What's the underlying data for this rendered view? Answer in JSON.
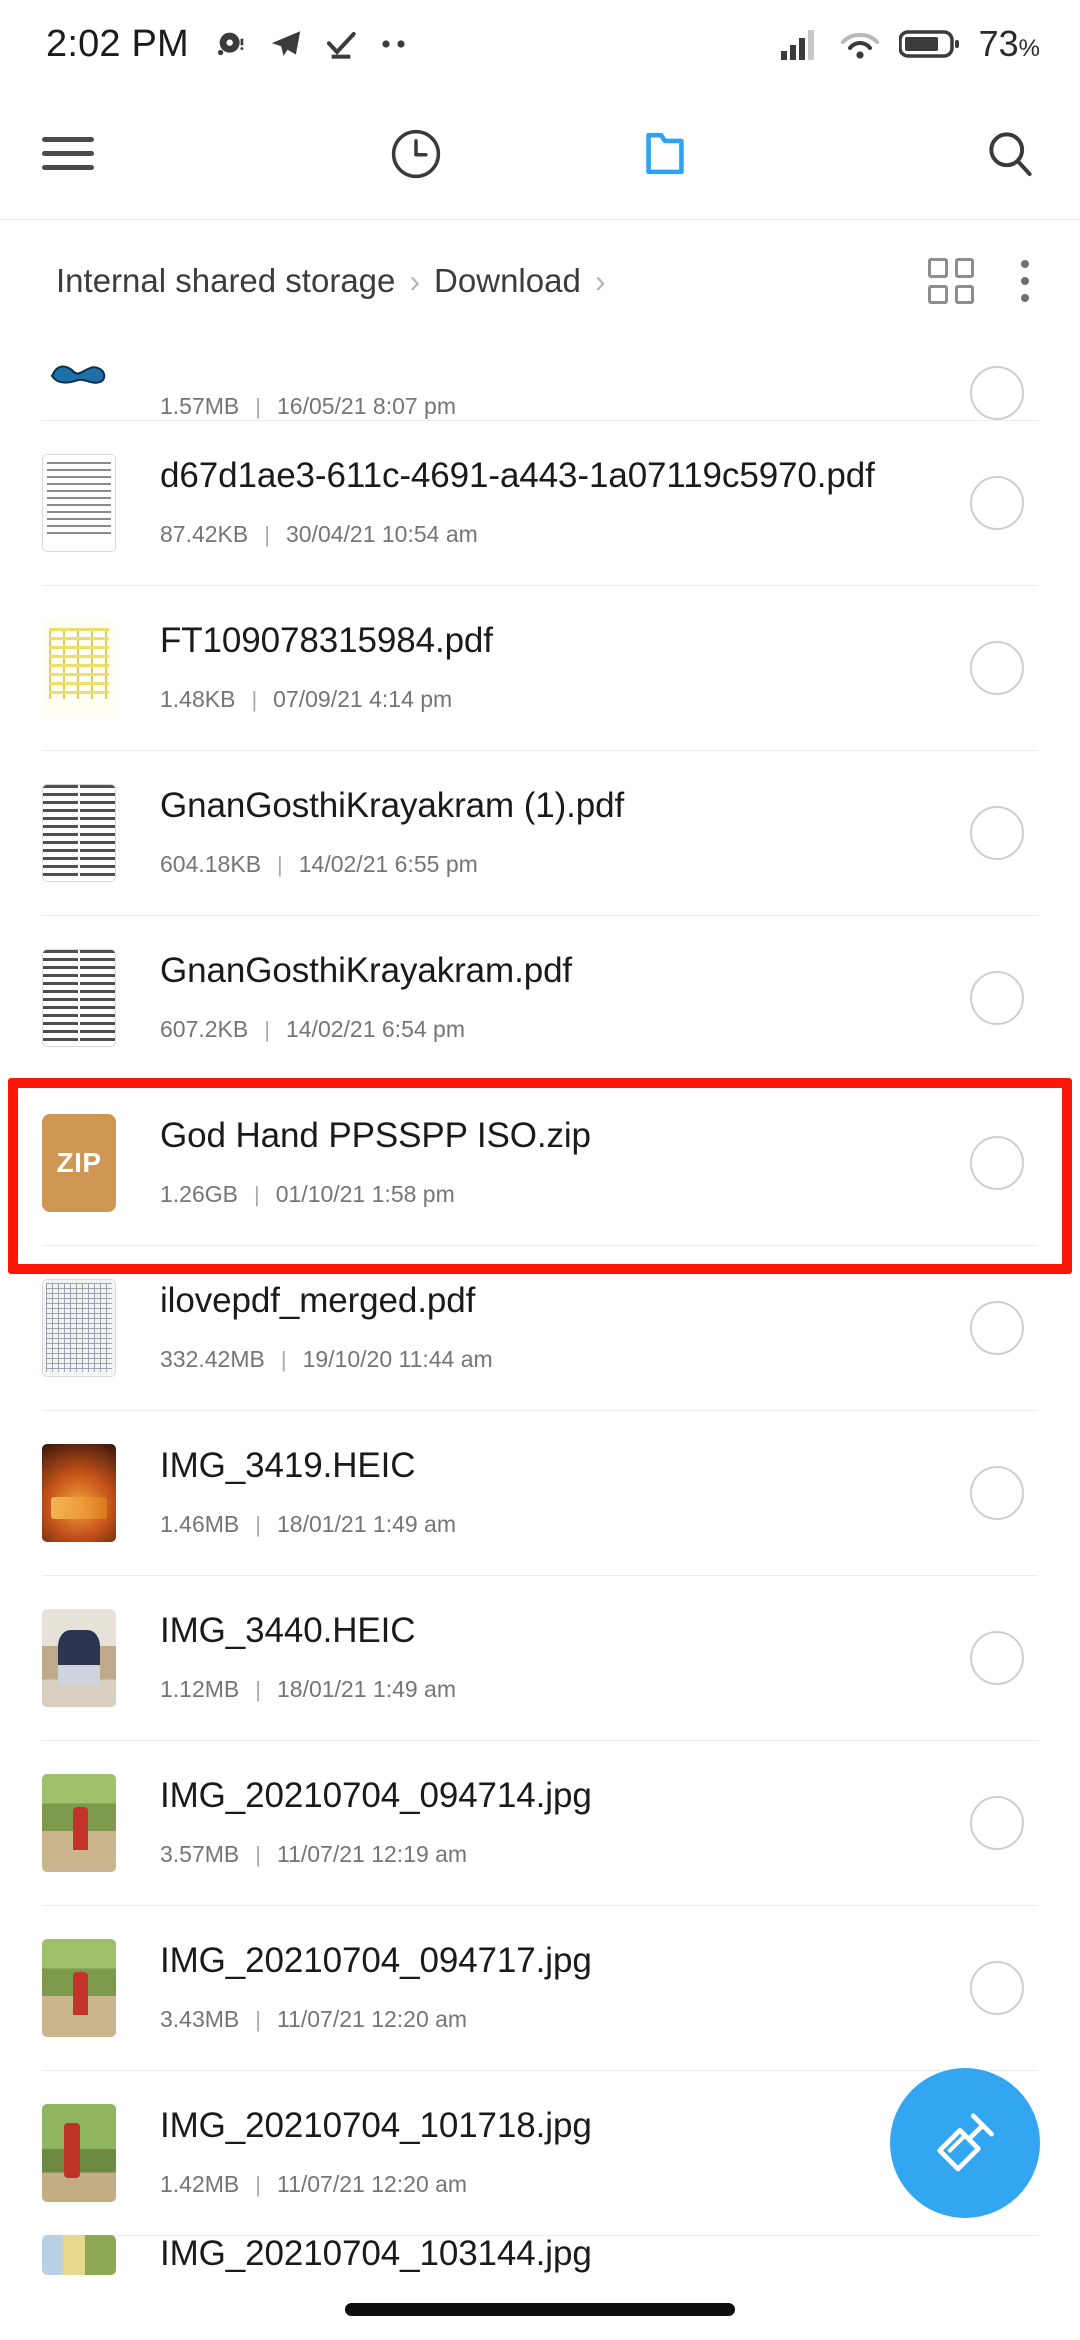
{
  "status_bar": {
    "time": "2:02 PM",
    "battery_percent": "73",
    "battery_unit": "%",
    "left_icons": [
      "notification-dot-icon",
      "telegram-icon",
      "check-icon",
      "more-dots-icon"
    ],
    "right_icons": [
      "cellular-signal-icon",
      "wifi-icon",
      "battery-icon"
    ]
  },
  "toolbar": {
    "menu_icon": "hamburger-menu-icon",
    "recent_icon": "clock-icon",
    "files_icon": "folder-icon",
    "search_icon": "search-icon",
    "active_tab": "files",
    "accent_color": "#2EA3F2"
  },
  "breadcrumb": {
    "items": [
      "Internal shared storage",
      "Download"
    ],
    "separator": "›",
    "trailing_separator": "›",
    "grid_view_icon": "grid-view-icon",
    "overflow_icon": "kebab-menu-icon"
  },
  "files": [
    {
      "name": "",
      "size": "1.57MB",
      "date": "16/05/21 8:07 pm",
      "thumb": "blue-icon",
      "partial": "top"
    },
    {
      "name": "d67d1ae3-611c-4691-a443-1a07119c5970.pdf",
      "size": "87.42KB",
      "date": "30/04/21 10:54 am",
      "thumb": "doc-lines"
    },
    {
      "name": "FT109078315984.pdf",
      "size": "1.48KB",
      "date": "07/09/21 4:14 pm",
      "thumb": "doc-yellow"
    },
    {
      "name": "GnanGosthiKrayakram (1).pdf",
      "size": "604.18KB",
      "date": "14/02/21 6:55 pm",
      "thumb": "doc-two-col"
    },
    {
      "name": "GnanGosthiKrayakram.pdf",
      "size": "607.2KB",
      "date": "14/02/21 6:54 pm",
      "thumb": "doc-two-col"
    },
    {
      "name": "God Hand PPSSPP ISO.zip",
      "size": "1.26GB",
      "date": "01/10/21 1:58 pm",
      "thumb": "zip",
      "thumb_label": "ZIP",
      "highlighted": true
    },
    {
      "name": "ilovepdf_merged.pdf",
      "size": "332.42MB",
      "date": "19/10/20 11:44 am",
      "thumb": "doc-grid"
    },
    {
      "name": "IMG_3419.HEIC",
      "size": "1.46MB",
      "date": "18/01/21 1:49 am",
      "thumb": "photo-boss"
    },
    {
      "name": "IMG_3440.HEIC",
      "size": "1.12MB",
      "date": "18/01/21 1:49 am",
      "thumb": "photo-people"
    },
    {
      "name": "IMG_20210704_094714.jpg",
      "size": "3.57MB",
      "date": "11/07/21 12:19 am",
      "thumb": "photo-outdoor"
    },
    {
      "name": "IMG_20210704_094717.jpg",
      "size": "3.43MB",
      "date": "11/07/21 12:20 am",
      "thumb": "photo-outdoor"
    },
    {
      "name": "IMG_20210704_101718.jpg",
      "size": "1.42MB",
      "date": "11/07/21 12:20 am",
      "thumb": "photo-outdoor2"
    },
    {
      "name": "IMG_20210704_103144.jpg",
      "size": "",
      "date": "",
      "thumb": "photo-sky",
      "partial": "bottom"
    }
  ],
  "fab": {
    "icon": "paintbrush-clean-icon",
    "color": "#33A6F2"
  },
  "highlight": {
    "color": "#FC1707",
    "target": "God Hand PPSSPP ISO.zip"
  },
  "separator_char": "|"
}
